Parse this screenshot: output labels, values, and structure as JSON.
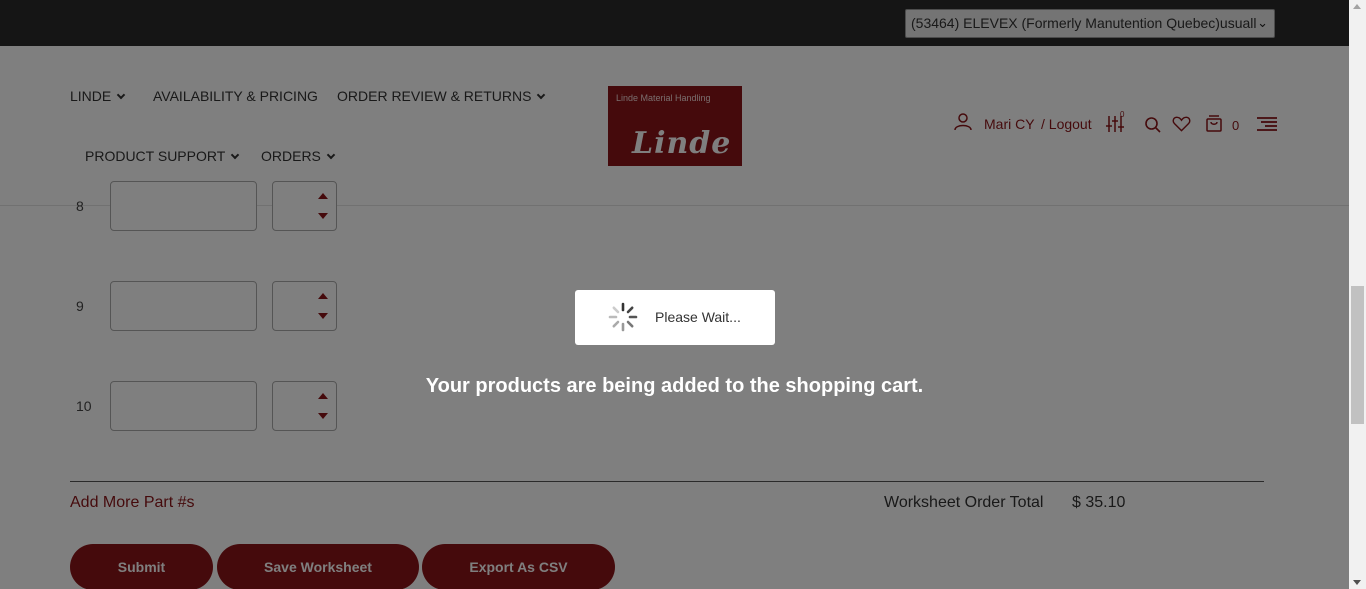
{
  "topbar": {
    "account_select_value": "(53464) ELEVEX (Formerly Manutention Quebec)usuall"
  },
  "nav": {
    "items": [
      {
        "label": "LINDE",
        "has_dropdown": true
      },
      {
        "label": "AVAILABILITY & PRICING",
        "has_dropdown": false
      },
      {
        "label": "ORDER REVIEW & RETURNS",
        "has_dropdown": true
      },
      {
        "label": "PRODUCT SUPPORT",
        "has_dropdown": true
      },
      {
        "label": "ORDERS",
        "has_dropdown": true
      }
    ]
  },
  "logo": {
    "tagline": "Linde Material Handling",
    "wordmark": "Linde"
  },
  "header_right": {
    "user_name": "Mari CY",
    "logout_label": "/ Logout",
    "compare_count": "0",
    "cart_count": "0"
  },
  "worksheet": {
    "rows": [
      {
        "num": "8"
      },
      {
        "num": "9"
      },
      {
        "num": "10"
      }
    ],
    "add_more_label": "Add More Part #s",
    "total_label": "Worksheet Order Total",
    "total_value": "$ 35.10",
    "buttons": {
      "submit": "Submit",
      "save": "Save Worksheet",
      "export": "Export As CSV"
    }
  },
  "overlay": {
    "wait_text": "Please Wait...",
    "message": "Your products are being added to the shopping cart."
  },
  "colors": {
    "brand": "#8b1518",
    "topbar": "#2b2b2b"
  }
}
